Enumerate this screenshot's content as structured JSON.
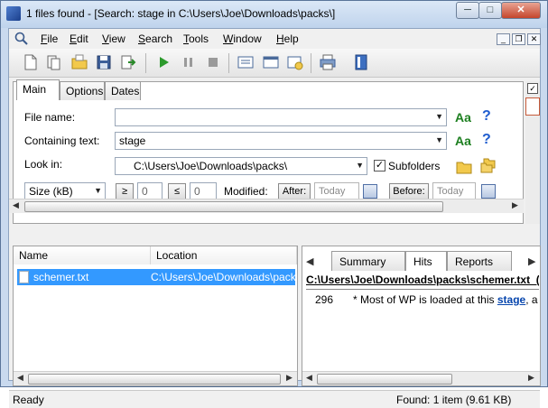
{
  "window": {
    "title": "1 files found - [Search: stage in C:\\Users\\Joe\\Downloads\\packs\\]",
    "min": "─",
    "max": "□",
    "close": "✕"
  },
  "menu": {
    "items": [
      {
        "label": "File",
        "u": "F",
        "rest": "ile"
      },
      {
        "label": "Edit",
        "u": "E",
        "rest": "dit"
      },
      {
        "label": "View",
        "u": "V",
        "rest": "iew"
      },
      {
        "label": "Search",
        "u": "S",
        "rest": "earch"
      },
      {
        "label": "Tools",
        "u": "T",
        "rest": "ools"
      },
      {
        "label": "Window",
        "u": "W",
        "rest": "indow"
      },
      {
        "label": "Help",
        "u": "H",
        "rest": "elp"
      }
    ],
    "mdi_min": "_",
    "mdi_restore": "❐",
    "mdi_close": "✕"
  },
  "toolbar": {
    "icons": [
      "new-doc-icon",
      "open-doc-icon",
      "open-folder-icon",
      "save-icon",
      "export-icon",
      "play-icon",
      "pause-icon",
      "stop-icon",
      "results-icon",
      "window-icon",
      "settings-icon",
      "print-icon",
      "help-book-icon"
    ]
  },
  "criteria": {
    "tabs": [
      "Main",
      "Options",
      "Dates"
    ],
    "file_name_label": "File name:",
    "file_name_value": "",
    "containing_text_label": "Containing text:",
    "containing_text_value": "stage",
    "look_in_label": "Look in:",
    "look_in_value": "C:\\Users\\Joe\\Downloads\\packs\\",
    "subfolders_label": "Subfolders",
    "subfolders_checked": true,
    "size_label": "Size (kB)",
    "ge_label": "≥",
    "ge_value": "0",
    "le_label": "≤",
    "le_value": "0",
    "modified_label": "Modified:",
    "after_label": "After:",
    "after_placeholder": "Today",
    "before_label": "Before:",
    "before_placeholder": "Today",
    "case_icon_text": "Aa",
    "help_icon_text": "?"
  },
  "results": {
    "col_name": "Name",
    "col_location": "Location",
    "rows": [
      {
        "name": "schemer.txt",
        "location": "C:\\Users\\Joe\\Downloads\\pack"
      }
    ]
  },
  "preview": {
    "tabs": [
      "Summary",
      "Hits",
      "Reports"
    ],
    "active_tab": "Hits",
    "file_header": "C:\\Users\\Joe\\Downloads\\packs\\schemer.txt_(",
    "hit_line": "296",
    "hit_text_before": "* Most of WP is loaded at this ",
    "hit_match": "stage",
    "hit_text_after": ", a"
  },
  "status": {
    "left": "Ready",
    "right": "Found: 1 item (9.61 KB)"
  }
}
